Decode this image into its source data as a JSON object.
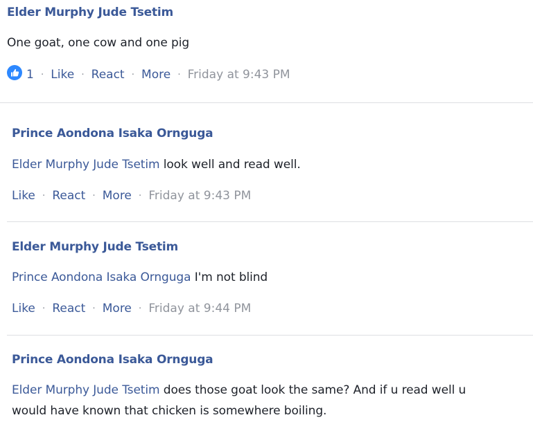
{
  "comments": [
    {
      "author": "Elder Murphy Jude Tsetim",
      "mention": "",
      "text": "One goat, one cow and one pig",
      "reaction_count": "1",
      "actions": {
        "like": "Like",
        "react": "React",
        "more": "More"
      },
      "time": "Friday at 9:43 PM"
    },
    {
      "author": "Prince Aondona Isaka Ornguga",
      "mention": "Elder Murphy Jude Tsetim",
      "text": " look well and read well.",
      "actions": {
        "like": "Like",
        "react": "React",
        "more": "More"
      },
      "time": "Friday at 9:43 PM"
    },
    {
      "author": "Elder Murphy Jude Tsetim",
      "mention": "Prince Aondona Isaka Ornguga",
      "text": " I'm not blind",
      "actions": {
        "like": "Like",
        "react": "React",
        "more": "More"
      },
      "time": "Friday at 9:44 PM"
    },
    {
      "author": "Prince Aondona Isaka Ornguga",
      "mention": "Elder Murphy Jude Tsetim",
      "text_line1": " does those goat look the same? And if u read well u",
      "text_line2": "would have known that chicken is somewhere boiling."
    }
  ],
  "colors": {
    "author": "#3b5998",
    "text": "#1d2129",
    "meta": "#90949c",
    "like_badge": "#2d88ff"
  },
  "icons": {
    "reaction": "thumbs-up-icon"
  }
}
